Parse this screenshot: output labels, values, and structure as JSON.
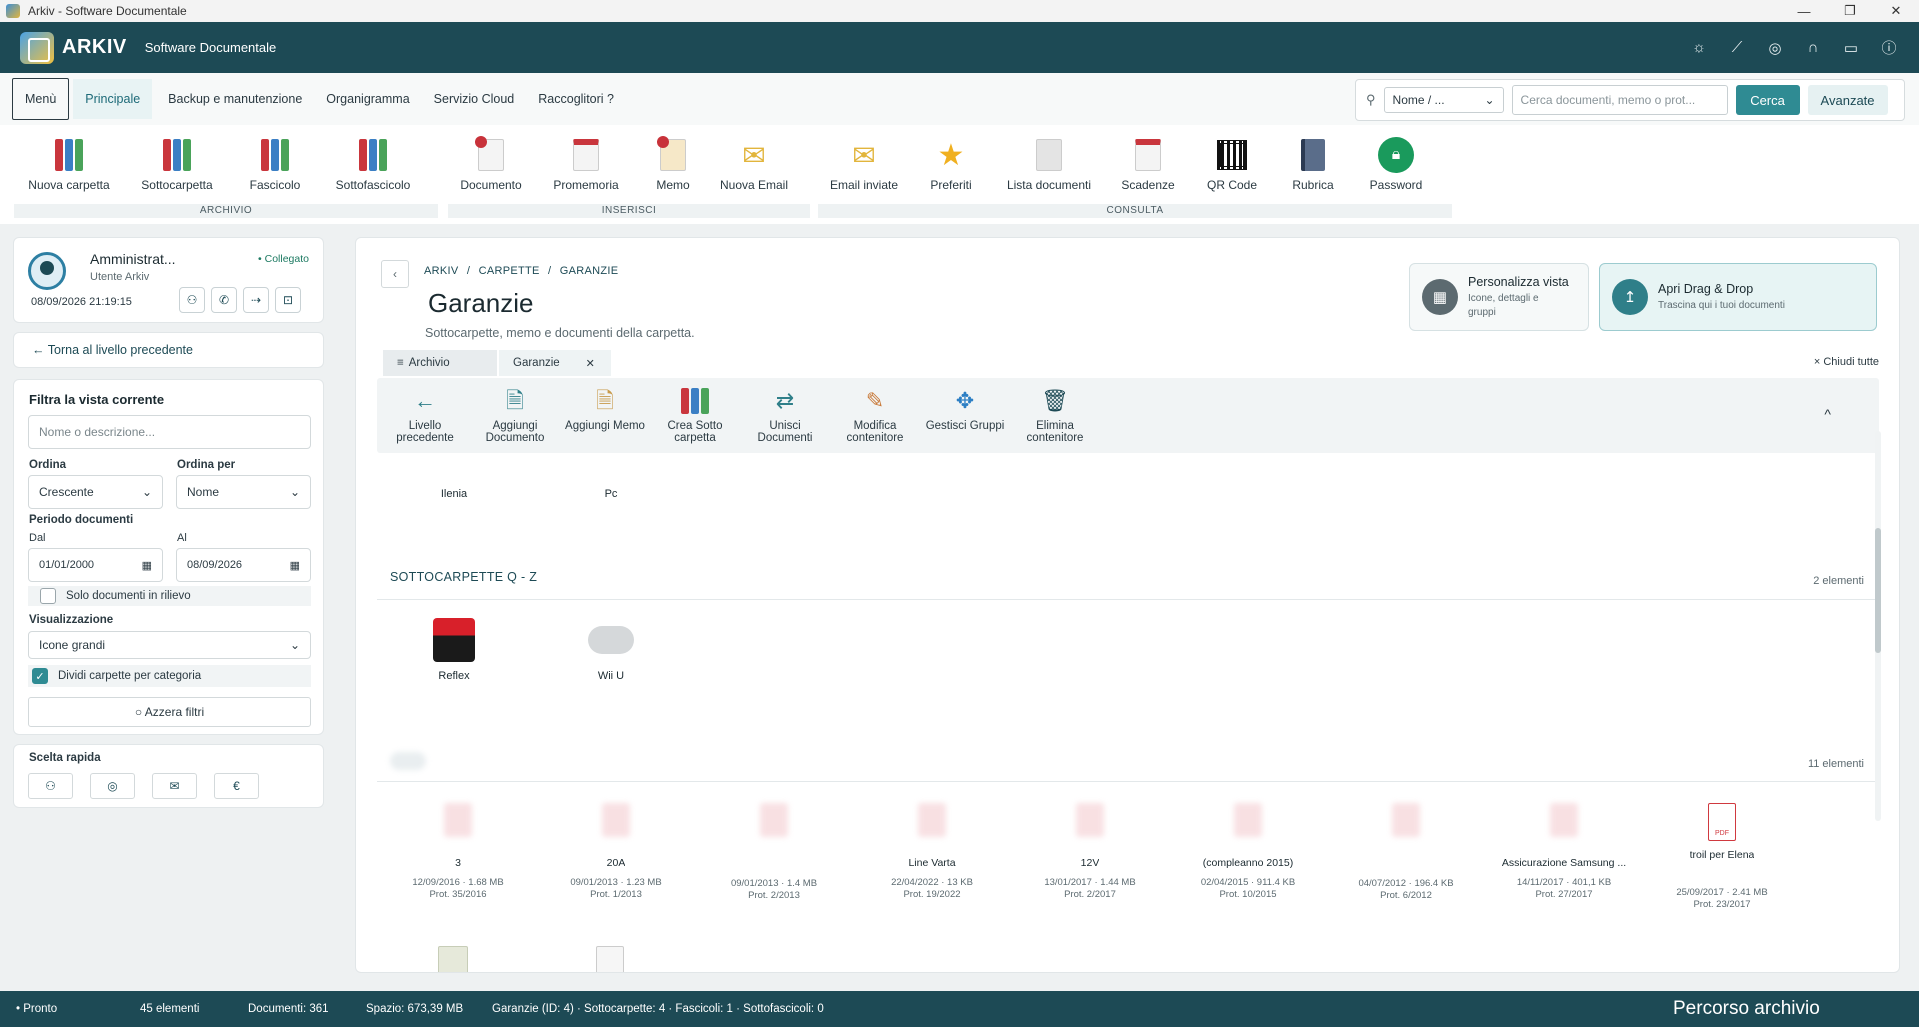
{
  "window": {
    "title": "Arkiv - Software Documentale"
  },
  "header": {
    "brand": "ARKIV",
    "subtitle": "Software Documentale"
  },
  "menubar": {
    "tabs": [
      "Menù",
      "Principale",
      "Backup e manutenzione",
      "Organigramma",
      "Servizio Cloud",
      "Raccoglitori ?"
    ],
    "search_mode": "Nome / ...",
    "search_placeholder": "Cerca documenti, memo o prot...",
    "search_button": "Cerca",
    "advanced_button": "Avanzate"
  },
  "ribbon": {
    "groups": {
      "archivio": "ARCHIVIO",
      "inserisci": "INSERISCI",
      "consulta": "CONSULTA"
    },
    "items": [
      "Nuova carpetta",
      "Sottocarpetta",
      "Fascicolo",
      "Sottofascicolo",
      "Documento",
      "Promemoria",
      "Memo",
      "Nuova Email",
      "Email inviate",
      "Preferiti",
      "Lista documenti",
      "Scadenze",
      "QR Code",
      "Rubrica",
      "Password"
    ]
  },
  "user": {
    "name": "Amministrat...",
    "role": "Utente Arkiv",
    "status": "• Collegato",
    "datetime": "08/09/2026 21:19:15"
  },
  "back_link": "← Torna al livello precedente",
  "filters": {
    "title": "Filtra la vista corrente",
    "name_placeholder": "Nome o descrizione...",
    "order_label": "Ordina",
    "order_value": "Crescente",
    "order_by_label": "Ordina per",
    "order_by_value": "Nome",
    "period_label": "Periodo documenti",
    "from_label": "Dal",
    "from_value": "01/01/2000",
    "to_label": "Al",
    "to_value": "08/09/2026",
    "highlight_label": "Solo documenti in rilievo",
    "view_label": "Visualizzazione",
    "view_value": "Icone grandi",
    "split_label": "Dividi carpette per categoria",
    "reset": "○ Azzera filtri"
  },
  "quick": {
    "title": "Scelta rapida"
  },
  "main": {
    "breadcrumb": [
      "ARKIV",
      "CARPETTE",
      "GARANZIE"
    ],
    "title": "Garanzie",
    "subtitle": "Sottocarpette, memo e documenti della carpetta.",
    "customize_title": "Personalizza vista",
    "customize_sub": "Icone, dettagli e gruppi",
    "drag_title": "Apri Drag & Drop",
    "drag_sub": "Trascina qui i tuoi documenti",
    "tab_archivio": "Archivio",
    "tab_current": "Garanzie",
    "close_all": "× Chiudi tutte",
    "actions": [
      "Livello precedente",
      "Aggiungi Documento",
      "Aggiungi Memo",
      "Crea Sotto carpetta",
      "Unisci Documenti",
      "Modifica contenitore",
      "Gestisci Gruppi",
      "Elimina contenitore"
    ],
    "prev_folders": [
      "Ilenia",
      "Pc"
    ],
    "section_qz": "SOTTOCARPETTE Q - Z",
    "section_qz_count": "2 elementi",
    "folders_qz": [
      "Reflex",
      "Wii U"
    ],
    "docs_count": "11 elementi",
    "docs": [
      {
        "name": "3",
        "meta1": "12/09/2016 · 1.68 MB",
        "meta2": "Prot. 35/2016"
      },
      {
        "name": "20A",
        "meta1": "09/01/2013 · 1.23 MB",
        "meta2": "Prot. 1/2013"
      },
      {
        "name": "",
        "meta1": "09/01/2013 · 1.4 MB",
        "meta2": "Prot. 2/2013"
      },
      {
        "name": "Line Varta",
        "meta1": "22/04/2022 · 13 KB",
        "meta2": "Prot. 19/2022"
      },
      {
        "name": "12V",
        "meta1": "13/01/2017 · 1.44 MB",
        "meta2": "Prot. 2/2017"
      },
      {
        "name": "(compleanno 2015)",
        "meta1": "02/04/2015 · 911.4 KB",
        "meta2": "Prot. 10/2015"
      },
      {
        "name": "",
        "meta1": "04/07/2012 · 196.4 KB",
        "meta2": "Prot. 6/2012"
      },
      {
        "name": "Assicurazione  Samsung ...",
        "meta1": "14/11/2017 · 401,1 KB",
        "meta2": "Prot. 27/2017"
      },
      {
        "name": "troil per Elena",
        "meta1": "25/09/2017 · 2.41 MB",
        "meta2": "Prot. 23/2017"
      }
    ]
  },
  "status": {
    "ready": "• Pronto",
    "elements": "45 elementi",
    "documents": "Documenti: 361",
    "space": "Spazio: 673,39 MB",
    "info": "Garanzie (ID: 4) · Sottocarpette: 4 · Fascicoli: 1 · Sottofascicoli: 0",
    "path": "Percorso archivio"
  }
}
